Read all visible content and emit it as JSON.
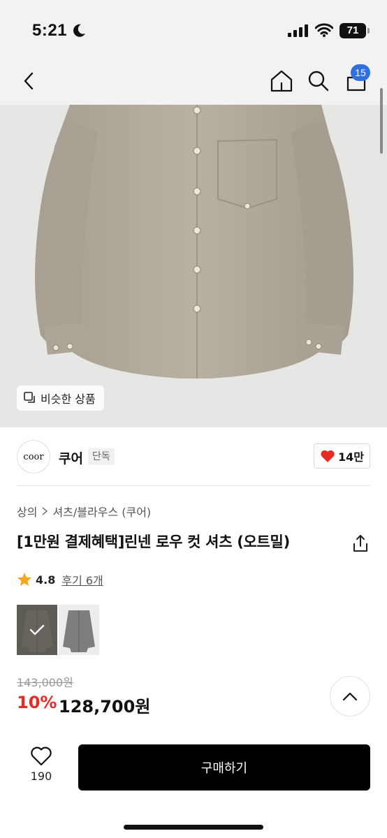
{
  "status_bar": {
    "time": "5:21",
    "battery": "71"
  },
  "nav": {
    "back_icon": "chevron-left-icon",
    "home_icon": "home-icon",
    "search_icon": "search-icon",
    "cart_icon": "cart-icon",
    "cart_count": "15"
  },
  "image": {
    "similar_label": "비슷한 상품"
  },
  "brand": {
    "logo_text": "coor",
    "name": "쿠어",
    "badge": "단독",
    "likes": "14만"
  },
  "breadcrumb": {
    "category": "상의",
    "subcategory": "셔츠/블라우스 (쿠어)"
  },
  "product": {
    "title": "[1만원 결제혜택]린넨 로우 컷 셔츠 (오트밀)",
    "rating": "4.8",
    "reviews": "후기 6개",
    "original_price": "143,000원",
    "discount": "10%",
    "sale_price": "128,700원"
  },
  "bottom": {
    "wish_count": "190",
    "buy_label": "구매하기"
  },
  "colors": {
    "accent_blue": "#2f6fe4",
    "discount_red": "#e52d27",
    "heart_red": "#e52d27",
    "star": "#f5a623",
    "shirt": "#b3ab9c"
  }
}
